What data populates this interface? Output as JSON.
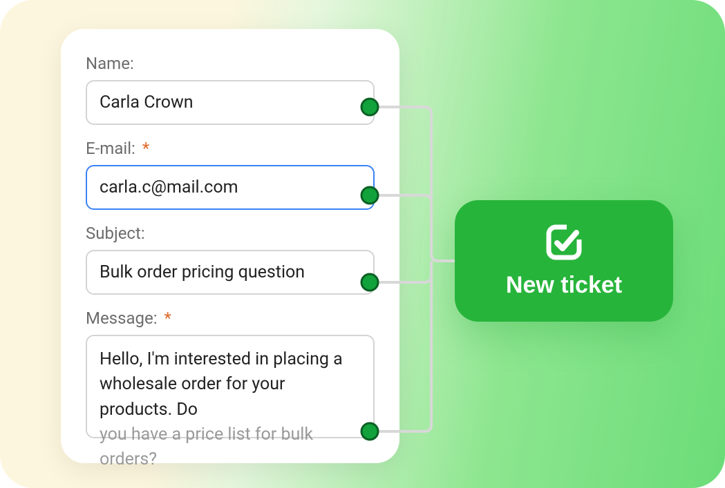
{
  "form": {
    "name": {
      "label": "Name:",
      "value": "Carla Crown"
    },
    "email": {
      "label": "E-mail:",
      "required": "*",
      "value": "carla.c@mail.com"
    },
    "subject": {
      "label": "Subject:",
      "value": "Bulk order pricing question"
    },
    "message": {
      "label": "Message:",
      "required": "*",
      "value_line1": "Hello, I'm interested in placing a",
      "value_line2": "wholesale order for your products. Do",
      "value_line3": "you have a price list for bulk orders?"
    }
  },
  "action": {
    "new_ticket": "New ticket"
  }
}
